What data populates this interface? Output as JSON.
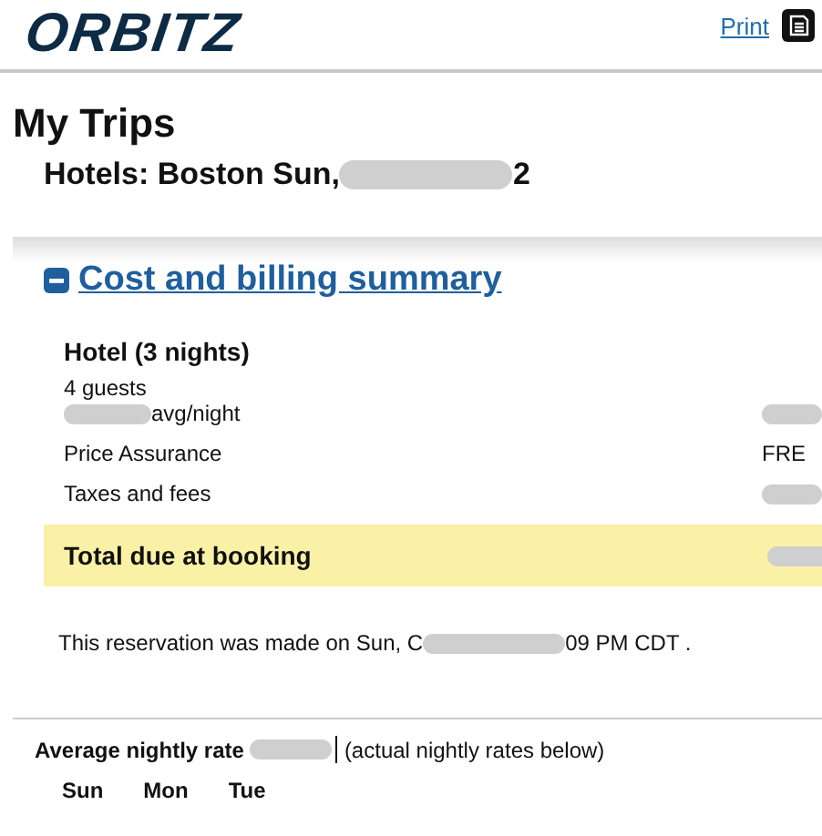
{
  "header": {
    "logo": "ORBITZ",
    "print_link": "Print"
  },
  "page_title": "My Trips",
  "trip_title": {
    "before": "Hotels: Boston Sun, ",
    "after": "2"
  },
  "section": {
    "title": "Cost and billing summary",
    "expanded": true,
    "hotel_heading": "Hotel (3 nights)",
    "guests": "4 guests",
    "rows": [
      {
        "label": "avg/night",
        "label_redacted": true,
        "value_redacted": true
      },
      {
        "label": "Price Assurance",
        "value": "FRE",
        "label_redacted": false,
        "value_redacted": false
      },
      {
        "label": "Taxes and fees",
        "label_redacted": false,
        "value_redacted": true
      }
    ],
    "total_label": "Total due at booking",
    "reservation": {
      "before": "This reservation was made on Sun, C",
      "after": "09 PM CDT ."
    }
  },
  "nightly": {
    "label": "Average nightly rate",
    "note": "(actual nightly rates below)",
    "days": [
      "Sun",
      "Mon",
      "Tue"
    ]
  }
}
